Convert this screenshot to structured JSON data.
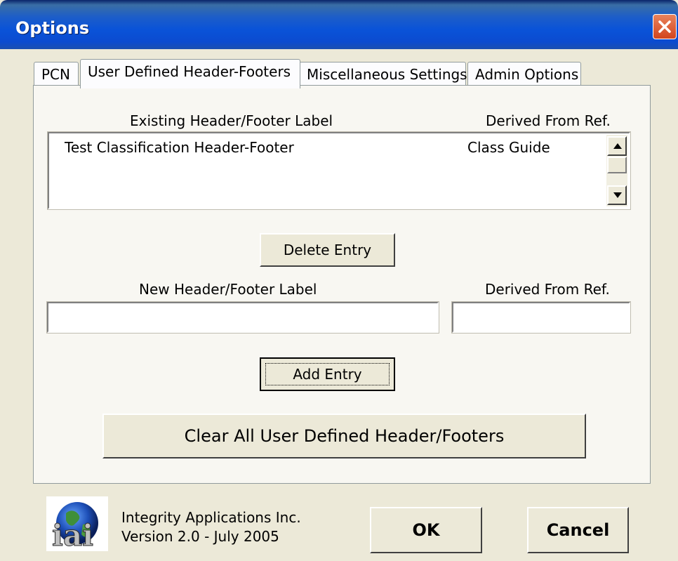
{
  "window": {
    "title": "Options"
  },
  "tabs": [
    {
      "label": "PCN",
      "active": false
    },
    {
      "label": "User Defined Header-Footers",
      "active": true
    },
    {
      "label": "Miscellaneous Settings",
      "active": false
    },
    {
      "label": "Admin Options",
      "active": false
    }
  ],
  "existing": {
    "label_header": "Existing Header/Footer Label",
    "ref_header": "Derived From Ref.",
    "rows": [
      {
        "label": "Test Classification Header-Footer",
        "ref": "Class Guide"
      }
    ]
  },
  "buttons": {
    "delete": "Delete Entry",
    "add": "Add Entry",
    "clear_all": "Clear All User Defined Header/Footers",
    "ok": "OK",
    "cancel": "Cancel"
  },
  "new_entry": {
    "label_header": "New Header/Footer Label",
    "ref_header": "Derived From Ref.",
    "label_value": "",
    "ref_value": ""
  },
  "footer": {
    "company": "Integrity Applications Inc.",
    "version": "Version 2.0 - July 2005",
    "logo_icon": "iai-globe-logo"
  }
}
